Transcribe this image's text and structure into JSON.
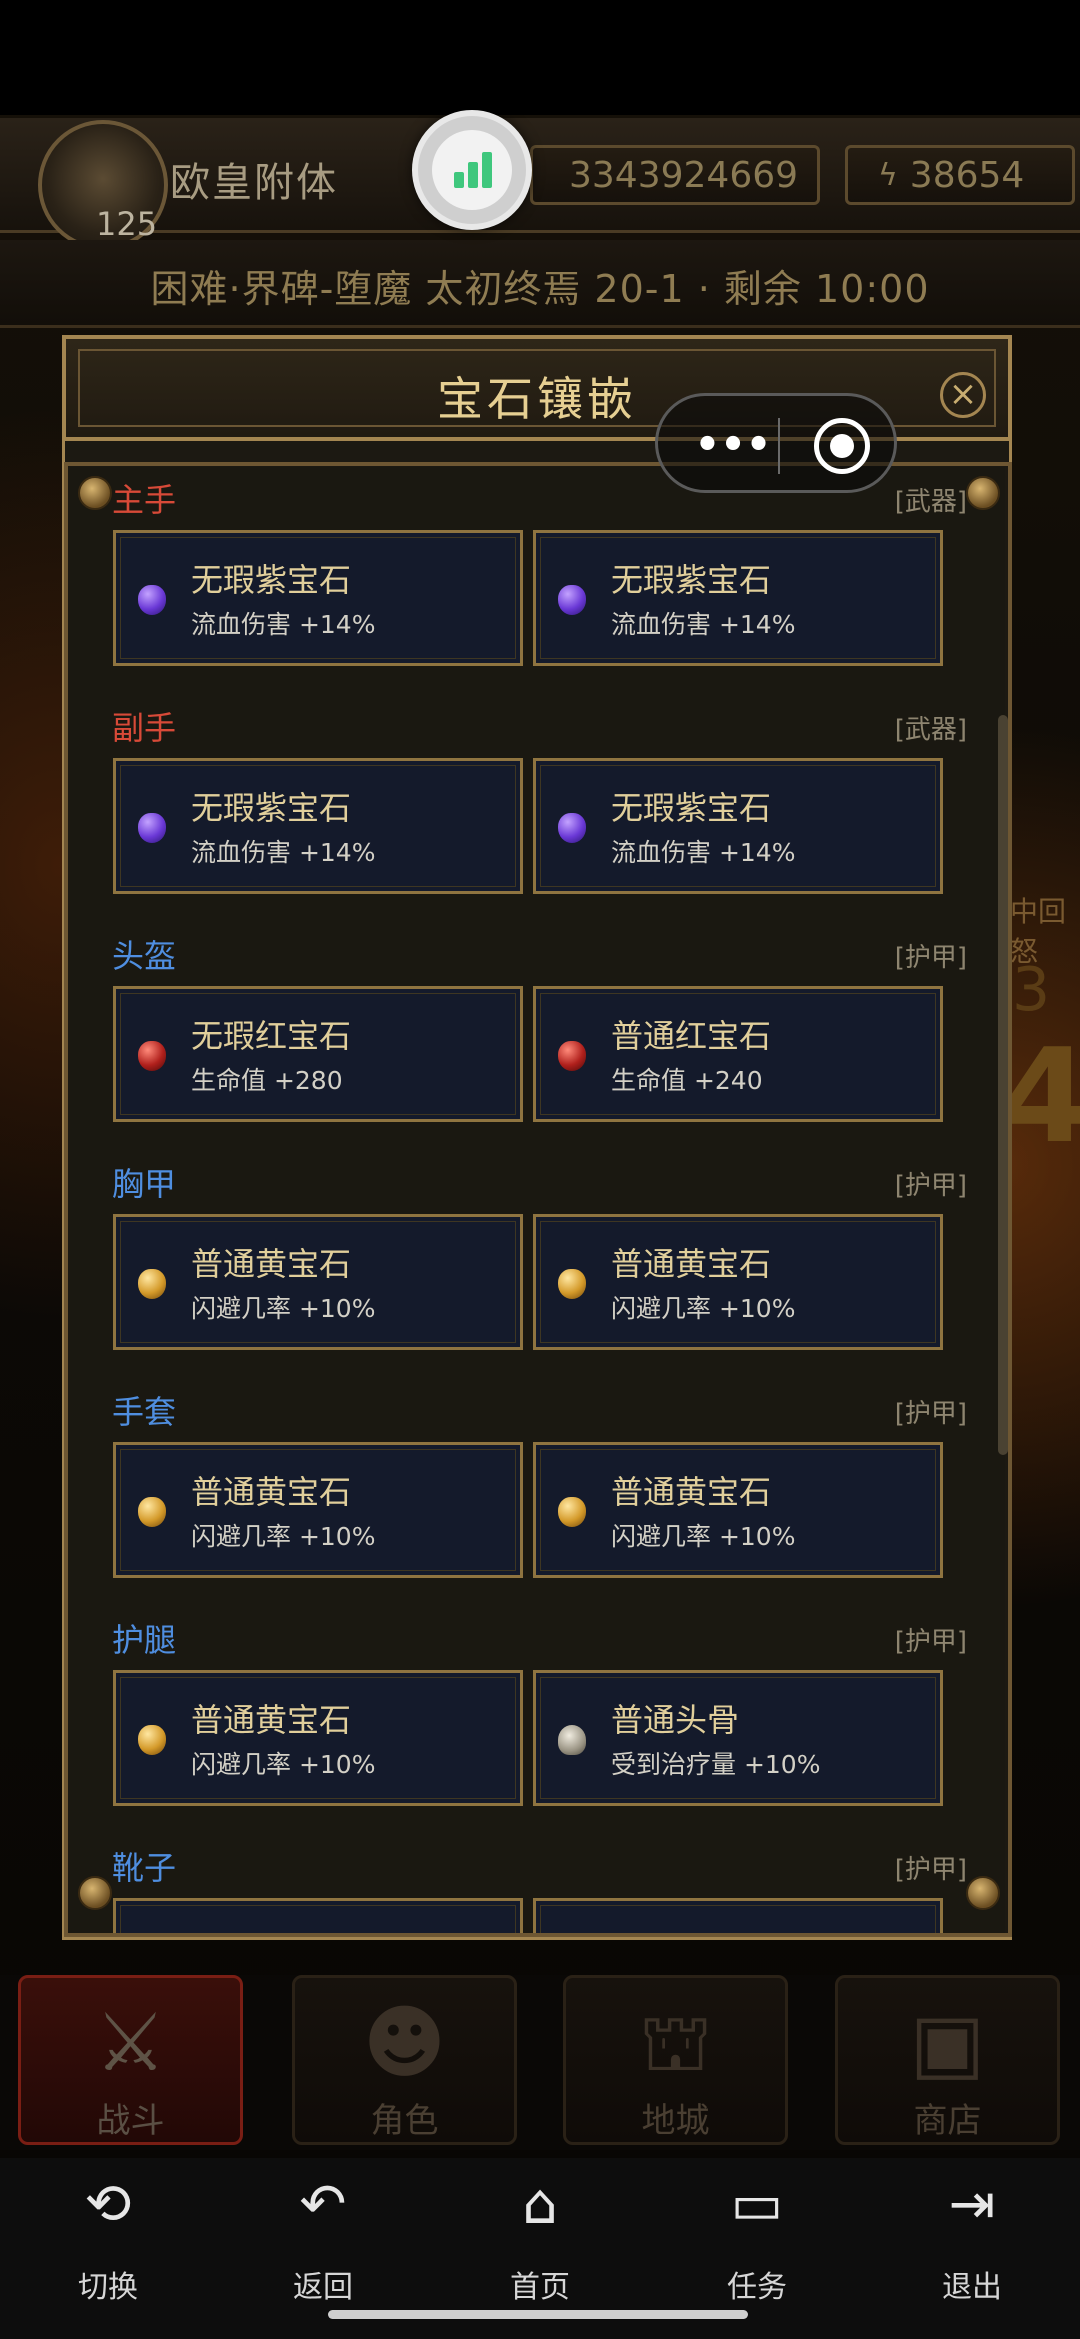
{
  "header": {
    "level": "125",
    "player_name": "欧皇附体",
    "gold": "3343924669",
    "power": "38654"
  },
  "stage_info": "困难·界碑-堕魔  太初终焉 20-1 · 剩余 10:00",
  "background_fragments": [
    "中回怒",
    "3",
    "4"
  ],
  "dialog": {
    "title": "宝石镶嵌",
    "sections": [
      {
        "slot": "主手",
        "type": "[武器]",
        "kind": "weapon",
        "gems": [
          {
            "name": "无瑕紫宝石",
            "stat": "流血伤害 +14%",
            "icon": "purple-gem-icon",
            "color": "#6a38d6"
          },
          {
            "name": "无瑕紫宝石",
            "stat": "流血伤害 +14%",
            "icon": "purple-gem-icon",
            "color": "#6a38d6"
          }
        ]
      },
      {
        "slot": "副手",
        "type": "[武器]",
        "kind": "weapon",
        "gems": [
          {
            "name": "无瑕紫宝石",
            "stat": "流血伤害 +14%",
            "icon": "purple-gem-icon",
            "color": "#6a38d6"
          },
          {
            "name": "无瑕紫宝石",
            "stat": "流血伤害 +14%",
            "icon": "purple-gem-icon",
            "color": "#6a38d6"
          }
        ]
      },
      {
        "slot": "头盔",
        "type": "[护甲]",
        "kind": "armor",
        "gems": [
          {
            "name": "无瑕红宝石",
            "stat": "生命值 +280",
            "icon": "red-gem-icon",
            "color": "#b0201c"
          },
          {
            "name": "普通红宝石",
            "stat": "生命值 +240",
            "icon": "red-gem-icon",
            "color": "#b0201c"
          }
        ]
      },
      {
        "slot": "胸甲",
        "type": "[护甲]",
        "kind": "armor",
        "gems": [
          {
            "name": "普通黄宝石",
            "stat": "闪避几率 +10%",
            "icon": "yellow-gem-icon",
            "color": "#d49a2a"
          },
          {
            "name": "普通黄宝石",
            "stat": "闪避几率 +10%",
            "icon": "yellow-gem-icon",
            "color": "#d49a2a"
          }
        ]
      },
      {
        "slot": "手套",
        "type": "[护甲]",
        "kind": "armor",
        "gems": [
          {
            "name": "普通黄宝石",
            "stat": "闪避几率 +10%",
            "icon": "yellow-gem-icon",
            "color": "#d49a2a"
          },
          {
            "name": "普通黄宝石",
            "stat": "闪避几率 +10%",
            "icon": "yellow-gem-icon",
            "color": "#d49a2a"
          }
        ]
      },
      {
        "slot": "护腿",
        "type": "[护甲]",
        "kind": "armor",
        "gems": [
          {
            "name": "普通黄宝石",
            "stat": "闪避几率 +10%",
            "icon": "yellow-gem-icon",
            "color": "#d49a2a"
          },
          {
            "name": "普通头骨",
            "stat": "受到治疗量 +10%",
            "icon": "skull-icon",
            "color": "#9a9484"
          }
        ]
      },
      {
        "slot": "靴子",
        "type": "[护甲]",
        "kind": "armor",
        "gems": []
      }
    ]
  },
  "game_nav": [
    {
      "label": "战斗",
      "icon": "crossed-swords-icon",
      "active": true
    },
    {
      "label": "角色",
      "icon": "character-icon",
      "active": false
    },
    {
      "label": "地城",
      "icon": "dungeon-gate-icon",
      "active": false
    },
    {
      "label": "商店",
      "icon": "shop-chest-icon",
      "active": false
    }
  ],
  "system_nav": [
    {
      "label": "切换",
      "icon": "switch-icon"
    },
    {
      "label": "返回",
      "icon": "back-icon"
    },
    {
      "label": "首页",
      "icon": "home-icon"
    },
    {
      "label": "任务",
      "icon": "tasks-icon"
    },
    {
      "label": "退出",
      "icon": "exit-icon"
    }
  ],
  "colors": {
    "weapon_slot": "#d84a38",
    "armor_slot": "#4f8ee0",
    "gold_frame": "#a48651",
    "card_bg": "#141a2b"
  }
}
